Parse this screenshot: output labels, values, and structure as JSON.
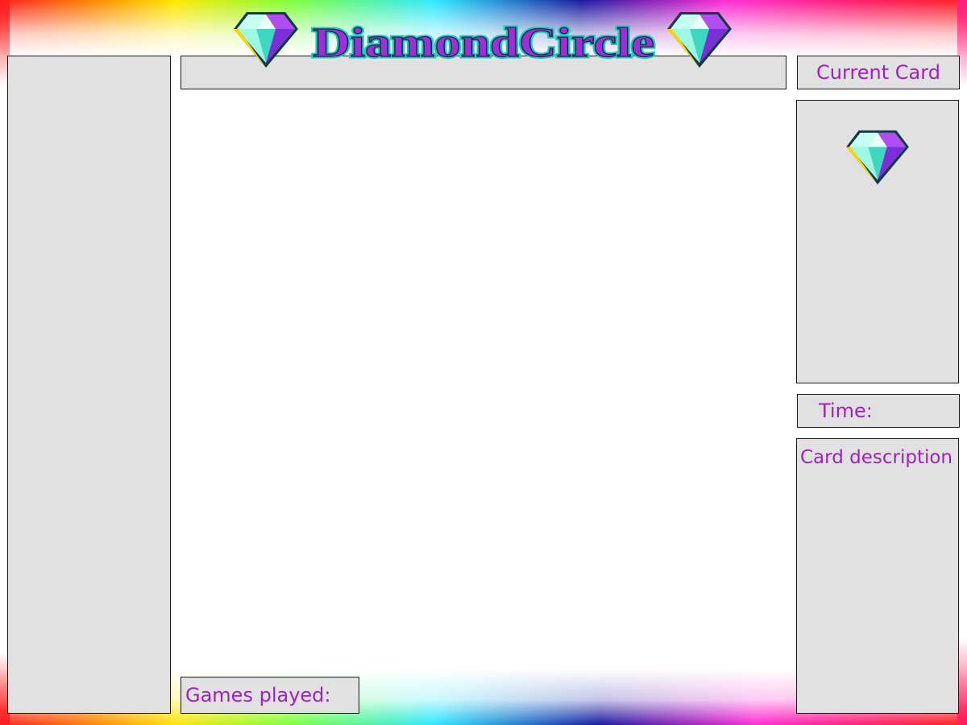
{
  "app": {
    "logo_text": "DiamondCircle"
  },
  "sidebar_right": {
    "current_card_label": "Current Card",
    "current_card_icon": "diamond-icon",
    "time_label": "Time:",
    "card_description_label": "Card description"
  },
  "footer": {
    "games_played_label": "Games played:"
  },
  "colors": {
    "label_text": "#a020c0",
    "panel_background": "#e1e1e1",
    "panel_border": "#1a1a1a",
    "logo_text_fill": "#9b2fd8",
    "logo_text_outline": "#1fc8c0"
  }
}
